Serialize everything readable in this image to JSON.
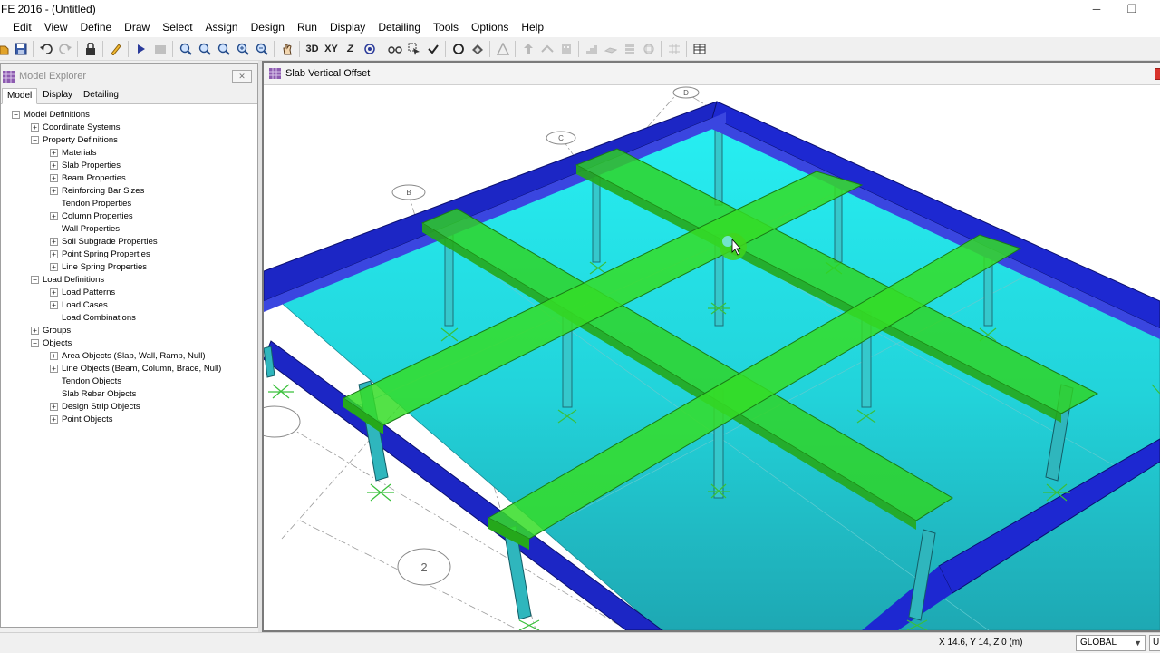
{
  "window": {
    "title": "FE 2016 - (Untitled)",
    "minimize_glyph": "─",
    "restore_glyph": "❐"
  },
  "menu": [
    "Edit",
    "View",
    "Define",
    "Draw",
    "Select",
    "Assign",
    "Design",
    "Run",
    "Display",
    "Detailing",
    "Tools",
    "Options",
    "Help"
  ],
  "toolbar": {
    "btn_3d": "3D",
    "btn_xy": "XY",
    "btn_z": "Z",
    "icons": [
      "open-icon",
      "save-icon",
      "undo-icon",
      "redo-icon",
      "lock-icon",
      "pencil-icon",
      "run-icon",
      "run-all-icon",
      "zoom-window-icon",
      "zoom-restore-icon",
      "zoom-in-icon",
      "zoom-plus-icon",
      "zoom-minus-icon",
      "pan-icon",
      "view-3d",
      "view-xy",
      "view-z",
      "rotate-icon",
      "glasses-icon",
      "select-icon",
      "check-icon",
      "circle-icon",
      "tilt-icon",
      "warning-icon"
    ]
  },
  "explorer": {
    "title": "Model Explorer",
    "close": "✕",
    "tabs": [
      "Model",
      "Display",
      "Detailing"
    ],
    "active_tab": "Model",
    "tree": [
      {
        "label": "Model Definitions",
        "level": 0,
        "expander": "−",
        "selected": true
      },
      {
        "label": "Coordinate Systems",
        "level": 1,
        "expander": "+"
      },
      {
        "label": "Property Definitions",
        "level": 1,
        "expander": "−"
      },
      {
        "label": "Materials",
        "level": 2,
        "expander": "+"
      },
      {
        "label": "Slab Properties",
        "level": 2,
        "expander": "+"
      },
      {
        "label": "Beam Properties",
        "level": 2,
        "expander": "+"
      },
      {
        "label": "Reinforcing Bar Sizes",
        "level": 2,
        "expander": "+"
      },
      {
        "label": "Tendon Properties",
        "level": 2,
        "expander": ""
      },
      {
        "label": "Column Properties",
        "level": 2,
        "expander": "+"
      },
      {
        "label": "Wall Properties",
        "level": 2,
        "expander": ""
      },
      {
        "label": "Soil Subgrade Properties",
        "level": 2,
        "expander": "+"
      },
      {
        "label": "Point Spring Properties",
        "level": 2,
        "expander": "+"
      },
      {
        "label": "Line Spring Properties",
        "level": 2,
        "expander": "+"
      },
      {
        "label": "Load Definitions",
        "level": 1,
        "expander": "−"
      },
      {
        "label": "Load Patterns",
        "level": 2,
        "expander": "+"
      },
      {
        "label": "Load Cases",
        "level": 2,
        "expander": "+"
      },
      {
        "label": "Load Combinations",
        "level": 2,
        "expander": ""
      },
      {
        "label": "Groups",
        "level": 1,
        "expander": "+"
      },
      {
        "label": "Objects",
        "level": 1,
        "expander": "−"
      },
      {
        "label": "Area Objects (Slab, Wall, Ramp, Null)",
        "level": 2,
        "expander": "+"
      },
      {
        "label": "Line Objects (Beam, Column, Brace, Null)",
        "level": 2,
        "expander": "+"
      },
      {
        "label": "Tendon Objects",
        "level": 2,
        "expander": ""
      },
      {
        "label": "Slab Rebar Objects",
        "level": 2,
        "expander": ""
      },
      {
        "label": "Design Strip Objects",
        "level": 2,
        "expander": "+"
      },
      {
        "label": "Point Objects",
        "level": 2,
        "expander": "+"
      }
    ]
  },
  "viewport": {
    "title": "Slab Vertical Offset",
    "colors": {
      "slab": "#22e5ea",
      "perimeter_beam": "#1d27c9",
      "drop_beam": "#2fd31f",
      "column": "#33c3c9",
      "support": "#2ec22a"
    },
    "grid_bubbles": [
      "D",
      "C",
      "B",
      "2"
    ]
  },
  "status": {
    "coordinates": "X 14.6,  Y 14,  Z 0  (m)",
    "coord_system": "GLOBAL",
    "units": "U"
  }
}
